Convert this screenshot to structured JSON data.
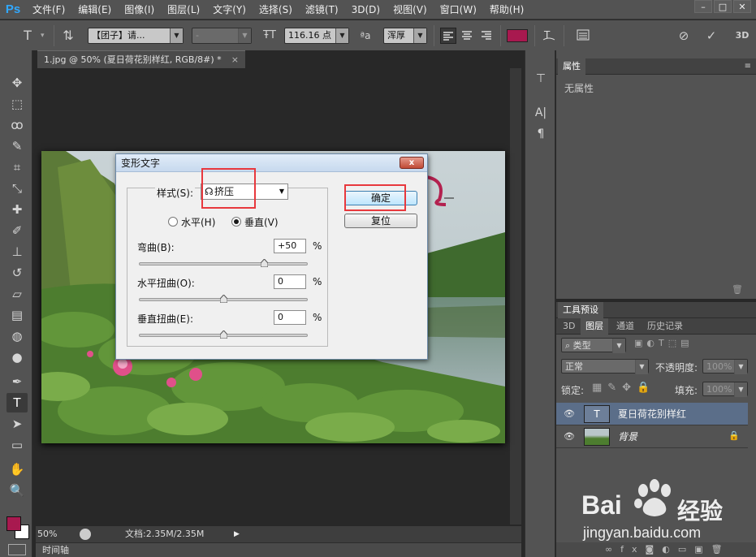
{
  "app": {
    "logo": "Ps"
  },
  "menu": [
    "文件(F)",
    "编辑(E)",
    "图像(I)",
    "图层(L)",
    "文字(Y)",
    "选择(S)",
    "滤镜(T)",
    "3D(D)",
    "视图(V)",
    "窗口(W)",
    "帮助(H)"
  ],
  "options": {
    "font_family": "【团子】请...",
    "font_style": "-",
    "font_size": "116.16 点",
    "aa_label": "ªa",
    "antialias": "浑厚",
    "text_color": "#a8194f",
    "mode_3d": "3D"
  },
  "document": {
    "tab_title": "1.jpg @ 50% (夏日荷花别样红, RGB/8#) *",
    "zoom": "50%",
    "doc_info": "文档:2.35M/2.35M"
  },
  "timeline_label": "时间轴",
  "colors": {
    "foreground": "#a8194f",
    "background": "#ffffff",
    "selected_layer": "#5b6e89",
    "accent_red": "#e8383d"
  },
  "properties": {
    "tab": "属性",
    "empty_text": "无属性"
  },
  "tool_presets_tab": "工具预设",
  "layers_panel": {
    "tabs": [
      "3D",
      "图层",
      "通道",
      "历史记录"
    ],
    "filter_kind": "类型",
    "blend_mode": "正常",
    "opacity_label": "不透明度:",
    "opacity_value": "100%",
    "lock_label": "锁定:",
    "fill_label": "填充:",
    "fill_value": "100%",
    "layers": [
      {
        "name": "夏日荷花别样红",
        "type": "text",
        "thumb": "T",
        "selected": true
      },
      {
        "name": "背景",
        "type": "image",
        "selected": false
      }
    ]
  },
  "dialog": {
    "title": "变形文字",
    "style_label": "样式(S):",
    "style_value": "挤压",
    "horizontal_label": "水平(H)",
    "vertical_label": "垂直(V)",
    "orientation": "vertical",
    "bend_label": "弯曲(B):",
    "bend_value": "+50",
    "hdistort_label": "水平扭曲(O):",
    "hdistort_value": "0",
    "vdistort_label": "垂直扭曲(E):",
    "vdistort_value": "0",
    "percent": "%",
    "ok_label": "确定",
    "reset_label": "复位",
    "close_label": "x"
  },
  "watermark": {
    "brand": "Bai",
    "brand2": "经验",
    "url": "jingyan.baidu.com"
  }
}
